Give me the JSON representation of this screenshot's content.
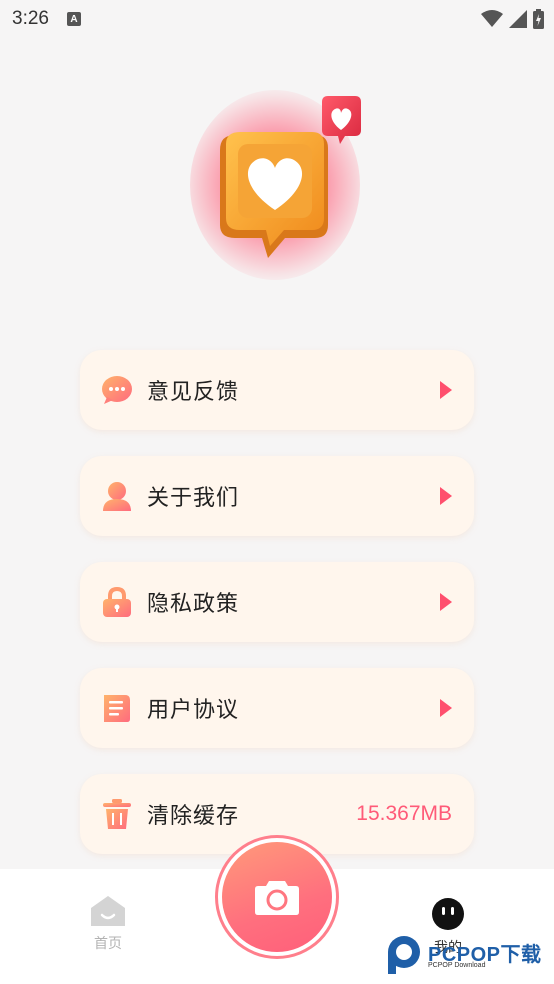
{
  "status_bar": {
    "time": "3:26",
    "notification_glyph": "A",
    "icons": [
      "wifi-icon",
      "signal-icon",
      "battery-icon"
    ]
  },
  "menu": {
    "items": [
      {
        "label": "意见反馈",
        "icon": "chat-bubble-icon"
      },
      {
        "label": "关于我们",
        "icon": "person-icon"
      },
      {
        "label": "隐私政策",
        "icon": "lock-icon"
      },
      {
        "label": "用户协议",
        "icon": "document-icon"
      },
      {
        "label": "清除缓存",
        "icon": "trash-icon",
        "value": "15.367MB"
      }
    ]
  },
  "tab_bar": {
    "home_label": "首页",
    "mine_label": "我的"
  },
  "watermark": {
    "brand": "PCPOP下载",
    "sub": "PCPOP Download"
  },
  "colors": {
    "accent": "#ff5a78",
    "card_bg": "#fff6ed",
    "icon_gradient_start": "#ffb36b",
    "icon_gradient_end": "#ff6b7e"
  }
}
